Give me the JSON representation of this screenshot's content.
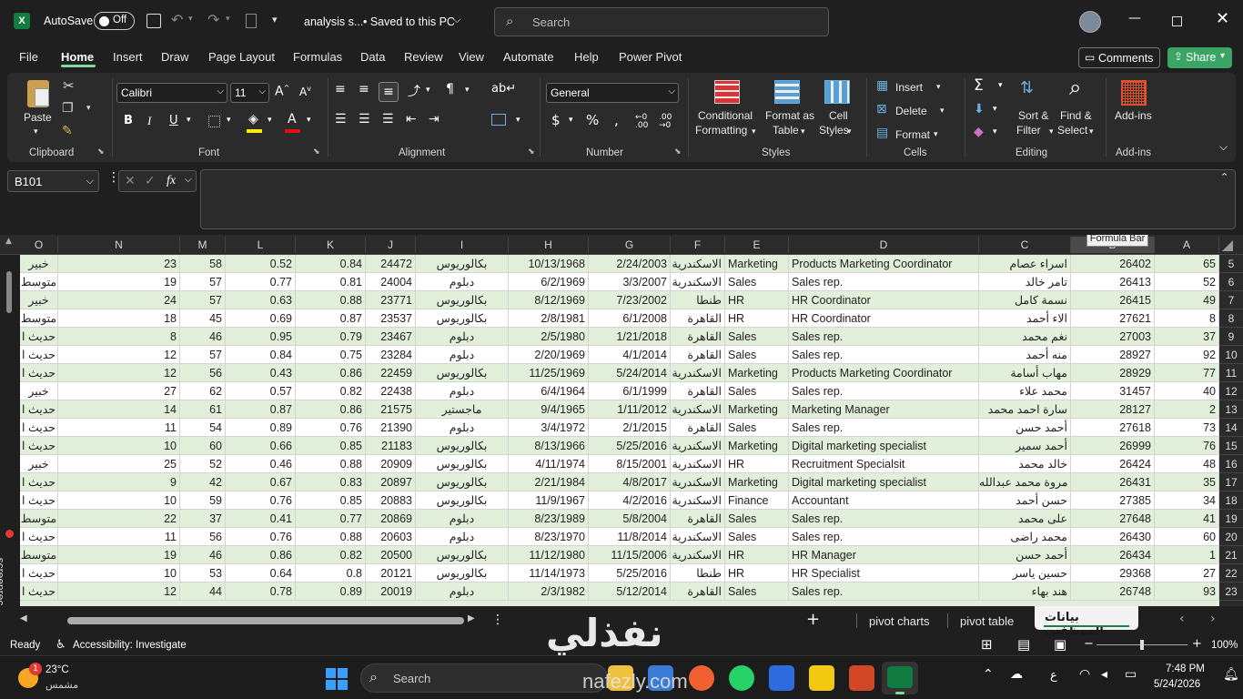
{
  "titlebar": {
    "autosave": "AutoSave",
    "autosave_state": "Off",
    "filename": "analysis s...",
    "saved": "• Saved to this PC",
    "search_placeholder": "Search"
  },
  "menu": {
    "items": [
      "File",
      "Home",
      "Insert",
      "Draw",
      "Page Layout",
      "Formulas",
      "Data",
      "Review",
      "View",
      "Automate",
      "Help",
      "Power Pivot"
    ],
    "active": "Home",
    "comments": "Comments",
    "share": "Share"
  },
  "ribbon": {
    "clipboard": {
      "paste": "Paste",
      "label": "Clipboard"
    },
    "font": {
      "name": "Calibri",
      "size": "11",
      "label": "Font"
    },
    "alignment": {
      "label": "Alignment"
    },
    "number": {
      "format": "General",
      "label": "Number"
    },
    "styles": {
      "conditional": "Conditional",
      "conditional2": "Formatting",
      "format_as": "Format as",
      "format_as2": "Table",
      "cell": "Cell",
      "cell2": "Styles",
      "label": "Styles"
    },
    "cells": {
      "insert": "Insert",
      "delete": "Delete",
      "format": "Format",
      "label": "Cells"
    },
    "editing": {
      "sort": "Sort &",
      "sort2": "Filter",
      "find": "Find &",
      "find2": "Select",
      "label": "Editing"
    },
    "addins": {
      "btn": "Add-ins",
      "label": "Add-ins"
    }
  },
  "formula": {
    "namebox": "B101",
    "fx": "fx",
    "tooltip": "Formula Bar"
  },
  "columns": [
    "O",
    "N",
    "M",
    "L",
    "K",
    "J",
    "I",
    "H",
    "G",
    "F",
    "E",
    "D",
    "C",
    "B",
    "A"
  ],
  "rows": [
    {
      "n": "5",
      "o": "خبير",
      "N": "23",
      "M": "58",
      "L": "0.52",
      "K": "0.84",
      "J": "24472",
      "I": "بكالوريوس",
      "H": "10/13/1968",
      "G": "2/24/2003",
      "F": "الاسكندرية",
      "E": "Marketing",
      "D": "Products Marketing Coordinator",
      "C": "اسراء عصام",
      "B": "26402",
      "A": "65"
    },
    {
      "n": "6",
      "o": "متوسط",
      "N": "19",
      "M": "57",
      "L": "0.77",
      "K": "0.81",
      "J": "24004",
      "I": "دبلوم",
      "H": "6/2/1969",
      "G": "3/3/2007",
      "F": "الاسكندرية",
      "E": "Sales",
      "D": "Sales rep.",
      "C": "تامر خالد",
      "B": "26413",
      "A": "52"
    },
    {
      "n": "7",
      "o": "خبير",
      "N": "24",
      "M": "57",
      "L": "0.63",
      "K": "0.88",
      "J": "23771",
      "I": "بكالوريوس",
      "H": "8/12/1969",
      "G": "7/23/2002",
      "F": "طنطا",
      "E": "HR",
      "D": "HR Coordinator",
      "C": "نسمة كامل",
      "B": "26415",
      "A": "49"
    },
    {
      "n": "8",
      "o": "متوسط",
      "N": "18",
      "M": "45",
      "L": "0.69",
      "K": "0.87",
      "J": "23537",
      "I": "بكالوريوس",
      "H": "2/8/1981",
      "G": "6/1/2008",
      "F": "القاهرة",
      "E": "HR",
      "D": "HR Coordinator",
      "C": "الاء أحمد",
      "B": "27621",
      "A": "8"
    },
    {
      "n": "9",
      "o": "حديث ا",
      "N": "8",
      "M": "46",
      "L": "0.95",
      "K": "0.79",
      "J": "23467",
      "I": "دبلوم",
      "H": "2/5/1980",
      "G": "1/21/2018",
      "F": "القاهرة",
      "E": "Sales",
      "D": "Sales rep.",
      "C": "نغم محمد",
      "B": "27003",
      "A": "37"
    },
    {
      "n": "10",
      "o": "حديث ا",
      "N": "12",
      "M": "57",
      "L": "0.84",
      "K": "0.75",
      "J": "23284",
      "I": "دبلوم",
      "H": "2/20/1969",
      "G": "4/1/2014",
      "F": "القاهرة",
      "E": "Sales",
      "D": "Sales rep.",
      "C": "منه أحمد",
      "B": "28927",
      "A": "92"
    },
    {
      "n": "11",
      "o": "حديث ا",
      "N": "12",
      "M": "56",
      "L": "0.43",
      "K": "0.86",
      "J": "22459",
      "I": "بكالوريوس",
      "H": "11/25/1969",
      "G": "5/24/2014",
      "F": "الاسكندرية",
      "E": "Marketing",
      "D": "Products Marketing Coordinator",
      "C": "مهاب أسامة",
      "B": "28929",
      "A": "77"
    },
    {
      "n": "12",
      "o": "خبير",
      "N": "27",
      "M": "62",
      "L": "0.57",
      "K": "0.82",
      "J": "22438",
      "I": "دبلوم",
      "H": "6/4/1964",
      "G": "6/1/1999",
      "F": "القاهرة",
      "E": "Sales",
      "D": "Sales rep.",
      "C": "محمد علاء",
      "B": "31457",
      "A": "40"
    },
    {
      "n": "13",
      "o": "حديث ا",
      "N": "14",
      "M": "61",
      "L": "0.87",
      "K": "0.86",
      "J": "21575",
      "I": "ماجستير",
      "H": "9/4/1965",
      "G": "1/11/2012",
      "F": "الاسكندرية",
      "E": "Marketing",
      "D": "Marketing Manager",
      "C": "سارة احمد محمد",
      "B": "28127",
      "A": "2"
    },
    {
      "n": "14",
      "o": "حديث ا",
      "N": "11",
      "M": "54",
      "L": "0.89",
      "K": "0.76",
      "J": "21390",
      "I": "دبلوم",
      "H": "3/4/1972",
      "G": "2/1/2015",
      "F": "القاهرة",
      "E": "Sales",
      "D": "Sales rep.",
      "C": "أحمد حسن",
      "B": "27618",
      "A": "73"
    },
    {
      "n": "15",
      "o": "حديث ا",
      "N": "10",
      "M": "60",
      "L": "0.66",
      "K": "0.85",
      "J": "21183",
      "I": "بكالوريوس",
      "H": "8/13/1966",
      "G": "5/25/2016",
      "F": "الاسكندرية",
      "E": "Marketing",
      "D": "Digital marketing specialist",
      "C": "أحمد سمير",
      "B": "26999",
      "A": "76"
    },
    {
      "n": "16",
      "o": "خبير",
      "N": "25",
      "M": "52",
      "L": "0.46",
      "K": "0.88",
      "J": "20909",
      "I": "بكالوريوس",
      "H": "4/11/1974",
      "G": "8/15/2001",
      "F": "الاسكندرية",
      "E": "HR",
      "D": "Recruitment Specialsit",
      "C": "خالد محمد",
      "B": "26424",
      "A": "48"
    },
    {
      "n": "17",
      "o": "حديث ا",
      "N": "9",
      "M": "42",
      "L": "0.67",
      "K": "0.83",
      "J": "20897",
      "I": "بكالوريوس",
      "H": "2/21/1984",
      "G": "4/8/2017",
      "F": "الاسكندرية",
      "E": "Marketing",
      "D": "Digital marketing specialist",
      "C": "مروة محمد عبدالله",
      "B": "26431",
      "A": "35"
    },
    {
      "n": "18",
      "o": "حديث ا",
      "N": "10",
      "M": "59",
      "L": "0.76",
      "K": "0.85",
      "J": "20883",
      "I": "بكالوريوس",
      "H": "11/9/1967",
      "G": "4/2/2016",
      "F": "الاسكندرية",
      "E": "Finance",
      "D": "Accountant",
      "C": "حسن أحمد",
      "B": "27385",
      "A": "34"
    },
    {
      "n": "19",
      "o": "متوسط",
      "N": "22",
      "M": "37",
      "L": "0.41",
      "K": "0.77",
      "J": "20869",
      "I": "دبلوم",
      "H": "8/23/1989",
      "G": "5/8/2004",
      "F": "القاهرة",
      "E": "Sales",
      "D": "Sales rep.",
      "C": "على محمد",
      "B": "27648",
      "A": "41"
    },
    {
      "n": "20",
      "o": "حديث ا",
      "N": "11",
      "M": "56",
      "L": "0.76",
      "K": "0.88",
      "J": "20603",
      "I": "دبلوم",
      "H": "8/23/1970",
      "G": "11/8/2014",
      "F": "الاسكندرية",
      "E": "Sales",
      "D": "Sales rep.",
      "C": "محمد راضى",
      "B": "26430",
      "A": "60"
    },
    {
      "n": "21",
      "o": "متوسط",
      "N": "19",
      "M": "46",
      "L": "0.86",
      "K": "0.82",
      "J": "20500",
      "I": "بكالوريوس",
      "H": "11/12/1980",
      "G": "11/15/2006",
      "F": "الاسكندرية",
      "E": "HR",
      "D": "HR Manager",
      "C": "أحمد حسن",
      "B": "26434",
      "A": "1"
    },
    {
      "n": "22",
      "o": "حديث ا",
      "N": "10",
      "M": "53",
      "L": "0.64",
      "K": "0.8",
      "J": "20121",
      "I": "بكالوريوس",
      "H": "11/14/1973",
      "G": "5/25/2016",
      "F": "طنطا",
      "E": "HR",
      "D": "HR Specialist",
      "C": "حسين ياسر",
      "B": "29368",
      "A": "27"
    },
    {
      "n": "23",
      "o": "حديث ا",
      "N": "12",
      "M": "44",
      "L": "0.78",
      "K": "0.89",
      "J": "20019",
      "I": "دبلوم",
      "H": "2/3/1982",
      "G": "5/12/2014",
      "F": "القاهرة",
      "E": "Sales",
      "D": "Sales rep.",
      "C": "هند بهاء",
      "B": "26748",
      "A": "93"
    }
  ],
  "sheets": {
    "tabs": [
      "pivot charts",
      "pivot table",
      "بيانات الموظفين"
    ],
    "active": "بيانات الموظفين"
  },
  "status": {
    "ready": "Ready",
    "accessibility": "Accessibility: Investigate",
    "zoom": "100%"
  },
  "taskbar": {
    "temp": "23°C",
    "weather": "مشمس",
    "search": "Search",
    "lang": "ع",
    "time": "7:48 PM",
    "date": "5/24/2026",
    "badge": "1"
  },
  "side": {
    "recorder": "screenrec"
  },
  "watermark": {
    "ar": "نفذلي",
    "latin": "nafezly.com"
  }
}
